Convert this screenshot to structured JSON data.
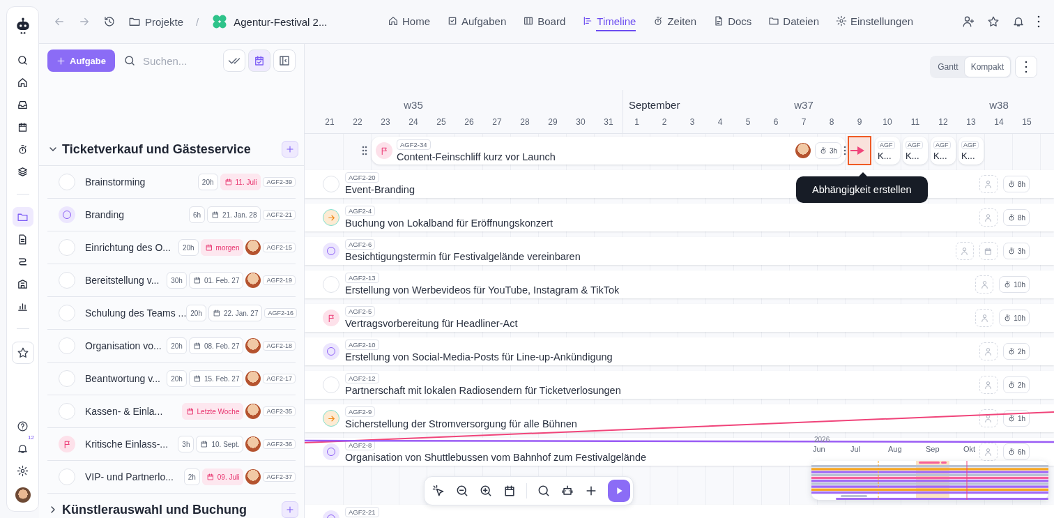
{
  "rail": {
    "top_items": [
      {
        "selected": false
      },
      {
        "selected": false
      },
      {
        "selected": false
      },
      {
        "selected": false
      },
      {
        "selected": false
      },
      {
        "selected": false
      }
    ],
    "project_items": [
      {
        "selected": true
      },
      {
        "selected": false
      },
      {
        "selected": false
      },
      {
        "selected": false
      },
      {
        "selected": false
      }
    ],
    "notification_badge": "12"
  },
  "topbar": {
    "breadcrumb": "Projekte",
    "separator": "/",
    "project": "Agentur-Festival 2...",
    "tabs": [
      {
        "label": "Home",
        "selected": false
      },
      {
        "label": "Aufgaben",
        "selected": false
      },
      {
        "label": "Board",
        "selected": false
      },
      {
        "label": "Timeline",
        "selected": true
      },
      {
        "label": "Zeiten",
        "selected": false
      },
      {
        "label": "Docs",
        "selected": false
      },
      {
        "label": "Dateien",
        "selected": false
      },
      {
        "label": "Einstellungen",
        "selected": false
      }
    ]
  },
  "left_panel": {
    "add_button": "Aufgabe",
    "search": {
      "placeholder": "Suchen..."
    },
    "view_buttons": [
      {
        "selected": false
      },
      {
        "selected": true
      },
      {
        "selected": false
      }
    ],
    "groups": [
      {
        "title": "Ticketverkauf und Gästeservice",
        "expanded": true,
        "tasks": [
          {
            "name": "Brainstorming",
            "kind": "open",
            "hours": "20h",
            "date": "11. Juli",
            "overdue": true,
            "assignee": false,
            "id": "AGF2-39"
          },
          {
            "name": "Branding",
            "kind": "in_progress",
            "hours": "6h",
            "date": "21. Jan. 28",
            "overdue": false,
            "assignee": false,
            "id": "AGF2-21"
          },
          {
            "name": "Einrichtung des O...",
            "kind": "open",
            "hours": "20h",
            "date": "morgen",
            "overdue": true,
            "assignee": true,
            "id": "AGF2-15"
          },
          {
            "name": "Bereitstellung v...",
            "kind": "open",
            "hours": "30h",
            "date": "01. Feb. 27",
            "overdue": false,
            "assignee": true,
            "id": "AGF2-19"
          },
          {
            "name": "Schulung des Teams ...",
            "kind": "open",
            "hours": "20h",
            "date": "22. Jan. 27",
            "overdue": false,
            "assignee": false,
            "id": "AGF2-16"
          },
          {
            "name": "Organisation vo...",
            "kind": "open",
            "hours": "20h",
            "date": "08. Feb. 27",
            "overdue": false,
            "assignee": true,
            "id": "AGF2-18"
          },
          {
            "name": "Beantwortung v...",
            "kind": "open",
            "hours": "20h",
            "date": "15. Feb. 27",
            "overdue": false,
            "assignee": true,
            "id": "AGF2-17"
          },
          {
            "name": "Kassen- & Einla...",
            "kind": "open",
            "date": "Letzte Woche",
            "overdue": true,
            "assignee": true,
            "id": "AGF2-35"
          },
          {
            "name": "Kritische Einlass-...",
            "kind": "flagged",
            "hours": "3h",
            "date": "10. Sept.",
            "overdue": false,
            "assignee": true,
            "id": "AGF2-36"
          },
          {
            "name": "VIP- und Partnerlo...",
            "kind": "open",
            "hours": "2h",
            "date": "09. Juli",
            "overdue": true,
            "assignee": true,
            "id": "AGF2-37"
          }
        ]
      },
      {
        "title": "Künstlerauswahl und Buchung",
        "expanded": false
      }
    ]
  },
  "timeline": {
    "view_modes": [
      {
        "label": "Gantt",
        "selected": false
      },
      {
        "label": "Kompakt",
        "selected": true
      }
    ],
    "days": [
      {
        "label": "21"
      },
      {
        "label": "22"
      },
      {
        "label": "23"
      },
      {
        "label": "24",
        "week": "w35"
      },
      {
        "label": "25"
      },
      {
        "label": "26"
      },
      {
        "label": "27"
      },
      {
        "label": "28"
      },
      {
        "label": "29"
      },
      {
        "label": "30"
      },
      {
        "label": "31"
      },
      {
        "label": "1",
        "month": "September"
      },
      {
        "label": "2"
      },
      {
        "label": "3"
      },
      {
        "label": "4"
      },
      {
        "label": "5"
      },
      {
        "label": "6"
      },
      {
        "label": "7",
        "week": "w37"
      },
      {
        "label": "8"
      },
      {
        "label": "9"
      },
      {
        "label": "10"
      },
      {
        "label": "11"
      },
      {
        "label": "12"
      },
      {
        "label": "13"
      },
      {
        "label": "14",
        "week": "w38"
      },
      {
        "label": "15"
      }
    ],
    "gantt_bar": {
      "id": "AGF2-34",
      "title": "Content-Feinschliff kurz vor Launch",
      "kind": "flagged",
      "assignee": true,
      "duration": "3h"
    },
    "milestones": [
      {
        "id": "AGF",
        "title": "K..."
      },
      {
        "id": "AGF",
        "title": "K..."
      },
      {
        "id": "AGF",
        "title": "K..."
      },
      {
        "id": "AGF",
        "title": "K..."
      }
    ],
    "tooltip": "Abhängigkeit erstellen",
    "rows": [
      {
        "id": "AGF2-20",
        "title": "Event-Branding",
        "kind": "open",
        "scheduled": false,
        "duration": "8h"
      },
      {
        "id": "AGF2-4",
        "title": "Buchung von Lokalband für Eröffnungskonzert",
        "kind": "next",
        "scheduled": false,
        "duration": "8h"
      },
      {
        "id": "AGF2-6",
        "title": "Besichtigungstermin für Festivalgelände vereinbaren",
        "kind": "in_progress",
        "scheduled": true,
        "duration": "3h"
      },
      {
        "id": "AGF2-13",
        "title": "Erstellung von Werbevideos für YouTube, Instagram & TikTok",
        "kind": "open",
        "scheduled": false,
        "duration": "10h"
      },
      {
        "id": "AGF2-5",
        "title": "Vertragsvorbereitung für Headliner-Act",
        "kind": "flagged",
        "scheduled": false,
        "duration": "10h"
      },
      {
        "id": "AGF2-10",
        "title": "Erstellung von Social-Media-Posts für Line-up-Ankündigung",
        "kind": "in_progress",
        "scheduled": false,
        "duration": "2h"
      },
      {
        "id": "AGF2-12",
        "title": "Partnerschaft mit lokalen Radiosendern für Ticketverlosungen",
        "kind": "open",
        "scheduled": false,
        "duration": "2h"
      },
      {
        "id": "AGF2-9",
        "title": "Sicherstellung der Stromversorgung für alle Bühnen",
        "kind": "next",
        "scheduled": false,
        "duration": "1h"
      },
      {
        "id": "AGF2-8",
        "title": "Organisation von Shuttlebussen vom Bahnhof zum Festivalgelände",
        "kind": "in_progress",
        "scheduled": false,
        "duration": "6h"
      },
      {
        "kind": "gap"
      },
      {
        "id": "AGF2-21",
        "kind": "in_progress",
        "scheduled": false
      }
    ],
    "minimap": {
      "year": "2026",
      "months": [
        "Jun",
        "Jul",
        "Aug",
        "Sep",
        "Okt"
      ]
    }
  }
}
